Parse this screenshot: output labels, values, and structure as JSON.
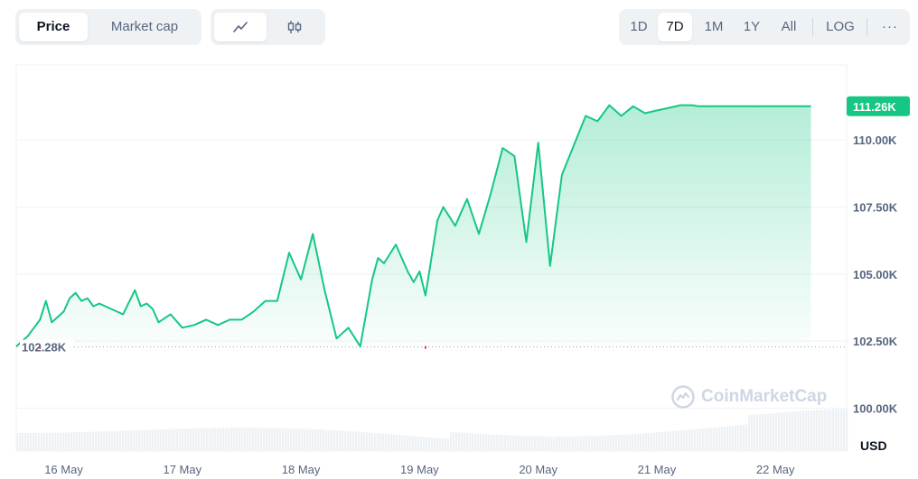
{
  "toolbar": {
    "tabs": [
      {
        "label": "Price",
        "active": true
      },
      {
        "label": "Market cap",
        "active": false
      }
    ],
    "view_icons": [
      "line-chart-icon",
      "candlestick-icon"
    ],
    "ranges": [
      {
        "label": "1D",
        "active": false
      },
      {
        "label": "7D",
        "active": true
      },
      {
        "label": "1M",
        "active": false
      },
      {
        "label": "1Y",
        "active": false
      },
      {
        "label": "All",
        "active": false
      }
    ],
    "log_label": "LOG",
    "more_label": "···"
  },
  "watermark": "CoinMarketCap",
  "colors": {
    "line": "#16c784",
    "baseline": "#9aa4b2",
    "reference_marker": "#ea3943",
    "text": "#0d1421",
    "muted": "#58667e"
  },
  "chart_data": {
    "type": "area",
    "currency_label": "USD",
    "y_tick_labels": [
      "100.00K",
      "102.50K",
      "105.00K",
      "107.50K",
      "110.00K"
    ],
    "y_ticks": [
      100000,
      102500,
      105000,
      107500,
      110000
    ],
    "ylim": [
      98400,
      112800
    ],
    "x_tick_labels": [
      "16 May",
      "17 May",
      "18 May",
      "19 May",
      "20 May",
      "21 May",
      "22 May"
    ],
    "x_ticks": [
      0.4,
      1.4,
      2.4,
      3.4,
      4.4,
      5.4,
      6.4
    ],
    "xlim": [
      0,
      7
    ],
    "baseline": {
      "value": 102280,
      "label": "102.28K"
    },
    "current": {
      "value": 111260,
      "label": "111.26K"
    },
    "grid": true,
    "x": [
      0,
      0.1,
      0.2,
      0.25,
      0.3,
      0.4,
      0.45,
      0.5,
      0.55,
      0.6,
      0.65,
      0.7,
      0.8,
      0.9,
      1.0,
      1.05,
      1.1,
      1.15,
      1.2,
      1.3,
      1.4,
      1.5,
      1.6,
      1.7,
      1.8,
      1.9,
      2.0,
      2.1,
      2.2,
      2.3,
      2.4,
      2.5,
      2.6,
      2.7,
      2.8,
      2.9,
      3.0,
      3.05,
      3.1,
      3.2,
      3.3,
      3.35,
      3.4,
      3.45,
      3.5,
      3.55,
      3.6,
      3.7,
      3.8,
      3.9,
      4.0,
      4.1,
      4.2,
      4.3,
      4.4,
      4.5,
      4.6,
      4.7,
      4.8,
      4.9,
      5.0,
      5.1,
      5.2,
      5.3,
      5.4,
      5.5,
      5.6,
      5.7,
      5.75,
      5.8,
      5.85,
      5.9,
      6.0,
      6.1,
      6.15,
      6.2,
      6.3,
      6.35,
      6.4,
      6.5,
      6.6,
      6.7
    ],
    "values": [
      102300,
      102700,
      103300,
      104000,
      103200,
      103600,
      104100,
      104300,
      104000,
      104100,
      103800,
      103900,
      103700,
      103500,
      104400,
      103800,
      103900,
      103700,
      103200,
      103500,
      103000,
      103100,
      103300,
      103100,
      103300,
      103300,
      103600,
      104000,
      104000,
      105800,
      104800,
      106500,
      104400,
      102600,
      103000,
      102300,
      104800,
      105600,
      105400,
      106100,
      105100,
      104700,
      105100,
      104200,
      105600,
      107000,
      107500,
      106800,
      107800,
      106500,
      108000,
      109700,
      109400,
      106200,
      109900,
      105300,
      108700,
      109800,
      110900,
      110700,
      111300,
      110900,
      111260,
      111000,
      111100,
      111200,
      111300,
      111300,
      111260,
      111260,
      111260,
      111260,
      111260,
      111260,
      111260,
      111260,
      111260,
      111260,
      111260,
      111260,
      111260,
      111260
    ],
    "volume_note": ""
  }
}
